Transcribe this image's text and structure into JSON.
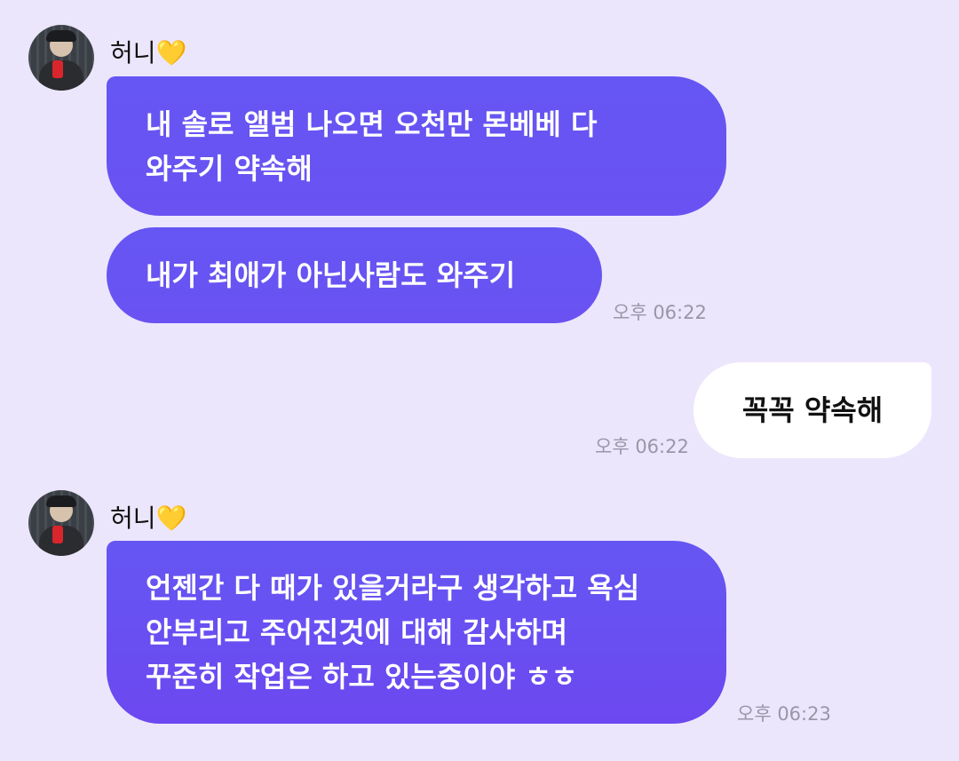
{
  "chat": {
    "messages": [
      {
        "sender": "허니💛",
        "lines": [
          "내 솔로 앨범 나오면 오천만 몬베베 다",
          "와주기 약속해"
        ]
      },
      {
        "lines": [
          "내가 최애가 아닌사람도 와주기"
        ],
        "time": "오후 06:22"
      },
      {
        "lines": [
          "꼭꼭 약속해"
        ],
        "time": "오후 06:22"
      },
      {
        "sender": "허니💛",
        "lines": [
          "언젠간 다 때가 있을거라구 생각하고 욕심",
          "안부리고 주어진것에 대해 감사하며",
          "꾸준히 작업은 하고 있는중이야 ㅎㅎ"
        ],
        "time": "오후 06:23"
      }
    ]
  }
}
